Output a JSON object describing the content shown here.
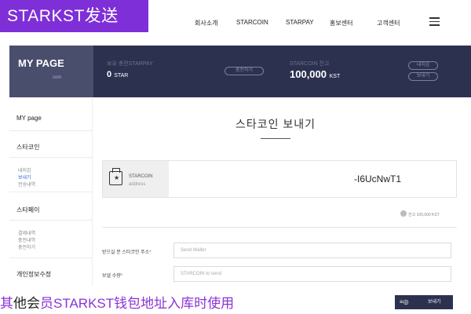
{
  "overlay_title": "STARKST发送",
  "nav": {
    "items": [
      "회사소개",
      "STARCOIN",
      "STARPAY",
      "홍보센터",
      "고객센터"
    ]
  },
  "banner": {
    "mypage_title": "MY PAGE",
    "mypage_sub": "com",
    "star_label": "보유 충전STARPAY",
    "star_value": "0",
    "star_unit": "STAR",
    "charge_btn": "충전하기",
    "coin_label": "STARCOIN 잔고",
    "coin_value": "100,000",
    "coin_unit": "KST",
    "wallet_btn": "내지갑",
    "send_btn": "보내기"
  },
  "sidebar": {
    "mypage": "MY page",
    "starcoin": "스타코인",
    "starcoin_items": [
      "내지갑",
      "보내기",
      "전송내역"
    ],
    "starpay": "스타페이",
    "starpay_items": [
      "결제내역",
      "충전내역",
      "충전하기"
    ],
    "edit_profile": "개인정보수정"
  },
  "main": {
    "title": "스타코인 보내기",
    "coin_name": "STARCOIN",
    "coin_sub": "address",
    "coin_address": "-I6UcNwT1",
    "balance": "잔고 100,000 KST",
    "recipient_label": "받으실 분 스타코인 주소",
    "recipient_placeholder": "Send Wallet",
    "amount_label": "보낼 수량",
    "amount_placeholder": "STARCOIN to send",
    "required_mark": "*"
  },
  "bottom": {
    "text_colored_1": "其",
    "text_black": "他会",
    "text_colored_2": "员STARKST钱包地址入库时使用",
    "send_button": "보내기",
    "send_button_icon": "≡◎"
  }
}
